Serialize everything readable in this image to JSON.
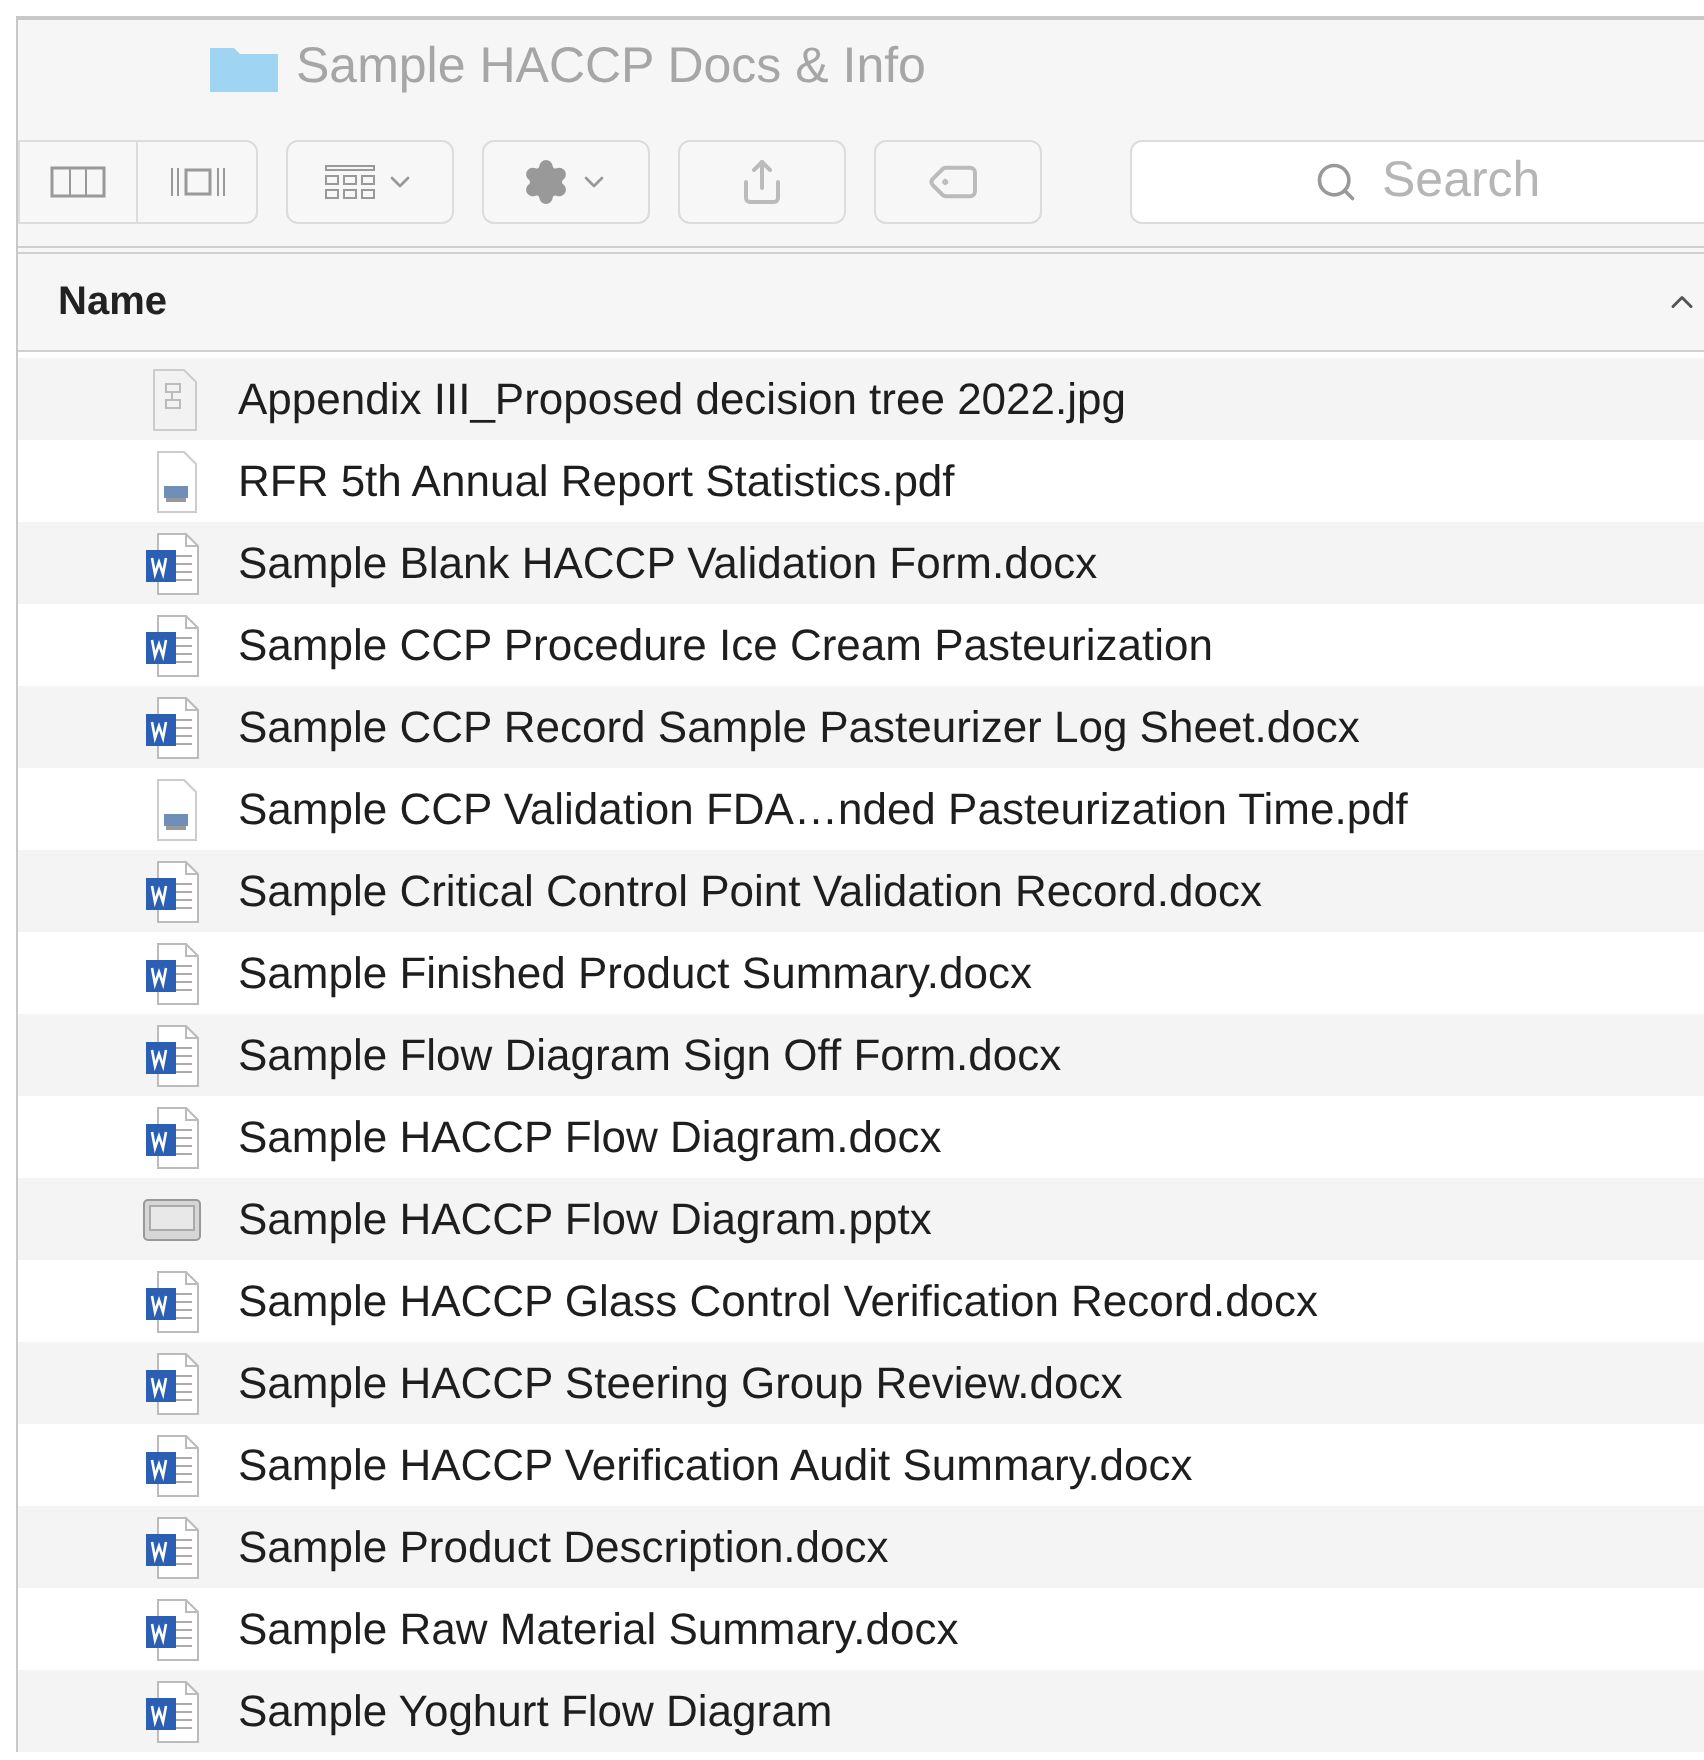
{
  "window": {
    "title": "Sample HACCP Docs & Info"
  },
  "search": {
    "placeholder": "Search"
  },
  "table": {
    "columns": [
      {
        "label": "Name"
      }
    ],
    "rows": [
      {
        "name": "Appendix III_Proposed decision tree 2022.jpg",
        "kind": "image"
      },
      {
        "name": "RFR 5th Annual Report Statistics.pdf",
        "kind": "pdf"
      },
      {
        "name": "Sample Blank HACCP Validation Form.docx",
        "kind": "word"
      },
      {
        "name": "Sample CCP Procedure Ice Cream Pasteurization",
        "kind": "word"
      },
      {
        "name": "Sample CCP Record Sample Pasteurizer Log Sheet.docx",
        "kind": "word"
      },
      {
        "name": "Sample CCP Validation FDA…nded Pasteurization Time.pdf",
        "kind": "pdf"
      },
      {
        "name": "Sample Critical Control Point Validation Record.docx",
        "kind": "word"
      },
      {
        "name": "Sample Finished Product Summary.docx",
        "kind": "word"
      },
      {
        "name": "Sample Flow Diagram Sign Off Form.docx",
        "kind": "word"
      },
      {
        "name": "Sample HACCP Flow Diagram.docx",
        "kind": "word"
      },
      {
        "name": "Sample HACCP Flow Diagram.pptx",
        "kind": "slides"
      },
      {
        "name": "Sample HACCP Glass Control Verification Record.docx",
        "kind": "word"
      },
      {
        "name": "Sample HACCP Steering Group Review.docx",
        "kind": "word"
      },
      {
        "name": "Sample HACCP Verification Audit Summary.docx",
        "kind": "word"
      },
      {
        "name": "Sample Product Description.docx",
        "kind": "word"
      },
      {
        "name": "Sample Raw Material Summary.docx",
        "kind": "word"
      },
      {
        "name": "Sample Yoghurt Flow Diagram",
        "kind": "word"
      }
    ]
  }
}
